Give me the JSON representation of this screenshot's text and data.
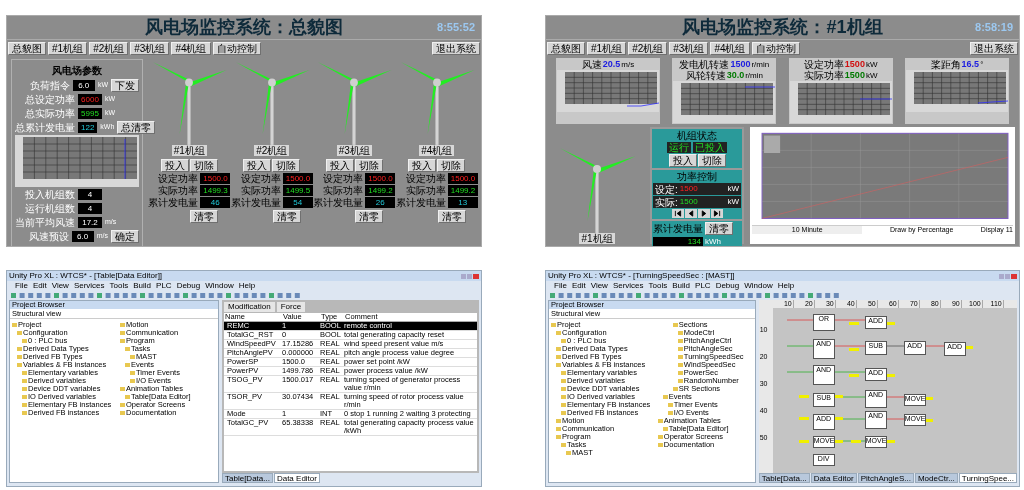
{
  "overview": {
    "title": "风电场监控系统：总貌图",
    "time": "8:55:52",
    "nav": [
      "总貌图",
      "#1机组",
      "#2机组",
      "#3机组",
      "#4机组",
      "自动控制"
    ],
    "exit_button": "退出系统",
    "farm_panel": {
      "title": "风电场参数",
      "top_rows": [
        {
          "label": "负荷指令",
          "value": "6.0",
          "unit": "kW",
          "button": "下发",
          "kind": "plain"
        },
        {
          "label": "总设定功率",
          "value": "6000",
          "unit": "kW",
          "kind": "setpoint"
        },
        {
          "label": "总实际功率",
          "value": "5995",
          "unit": "kW",
          "kind": "actual"
        },
        {
          "label": "总累计发电量",
          "value": "122",
          "unit": "kWh",
          "button": "总清零",
          "kind": "energy"
        }
      ],
      "bottom_rows": [
        {
          "label": "投入机组数",
          "value": "4",
          "kind": "plain"
        },
        {
          "label": "运行机组数",
          "value": "4",
          "kind": "plain"
        },
        {
          "label": "当前平均风速",
          "value": "17.2",
          "unit": "m/s",
          "kind": "plain"
        },
        {
          "label": "风速预设",
          "value": "6.0",
          "unit": "m/s",
          "button": "确定",
          "kind": "plain"
        }
      ]
    },
    "turbines": [
      {
        "name": "#1机组",
        "buttons": [
          "投入",
          "切除"
        ],
        "readings": [
          {
            "label": "设定功率",
            "value": "1500.0",
            "kind": "setpoint"
          },
          {
            "label": "实际功率",
            "value": "1499.3",
            "kind": "actual"
          },
          {
            "label": "累计发电量",
            "value": "46",
            "kind": "energy"
          }
        ],
        "clear_button": "清零"
      },
      {
        "name": "#2机组",
        "buttons": [
          "投入",
          "切除"
        ],
        "readings": [
          {
            "label": "设定功率",
            "value": "1500.0",
            "kind": "setpoint"
          },
          {
            "label": "实际功率",
            "value": "1499.5",
            "kind": "actual"
          },
          {
            "label": "累计发电量",
            "value": "54",
            "kind": "energy"
          }
        ],
        "clear_button": "清零"
      },
      {
        "name": "#3机组",
        "buttons": [
          "投入",
          "切除"
        ],
        "readings": [
          {
            "label": "设定功率",
            "value": "1500.0",
            "kind": "setpoint"
          },
          {
            "label": "实际功率",
            "value": "1499.2",
            "kind": "actual"
          },
          {
            "label": "累计发电量",
            "value": "26",
            "kind": "energy"
          }
        ],
        "clear_button": "清零"
      },
      {
        "name": "#4机组",
        "buttons": [
          "投入",
          "切除"
        ],
        "readings": [
          {
            "label": "设定功率",
            "value": "1500.0",
            "kind": "setpoint"
          },
          {
            "label": "实际功率",
            "value": "1499.2",
            "kind": "actual"
          },
          {
            "label": "累计发电量",
            "value": "13",
            "kind": "energy"
          }
        ],
        "clear_button": "清零"
      }
    ]
  },
  "unit_view": {
    "title": "风电场监控系统：#1机组",
    "time": "8:58:19",
    "nav": [
      "总貌图",
      "#1机组",
      "#2机组",
      "#3机组",
      "#4机组",
      "自动控制"
    ],
    "exit_button": "退出系统",
    "gauges": [
      {
        "captions": [
          {
            "label": "风速",
            "value": "20.5",
            "unit": "m/s",
            "kind": "process"
          }
        ]
      },
      {
        "captions": [
          {
            "label": "发电机转速",
            "value": "1500",
            "unit": "r/min",
            "kind": "process"
          },
          {
            "label": "风轮转速",
            "value": "30.0",
            "unit": "r/min",
            "kind": "actual"
          }
        ]
      },
      {
        "captions": [
          {
            "label": "设定功率",
            "value": "1500",
            "unit": "kW",
            "kind": "setpoint"
          },
          {
            "label": "实际功率",
            "value": "1500",
            "unit": "kW",
            "kind": "actual"
          }
        ]
      },
      {
        "captions": [
          {
            "label": "桨距角",
            "value": "16.5",
            "unit": "°",
            "kind": "process"
          }
        ]
      }
    ],
    "turbine_label": "#1机组",
    "status": {
      "title": "机组状态",
      "state": "运行",
      "input_state": "已投入",
      "buttons": [
        "投入",
        "切除"
      ]
    },
    "power": {
      "title": "功率控制",
      "rows": [
        {
          "label": "设定:",
          "value": "1500",
          "unit": "kW",
          "kind": "setpoint"
        },
        {
          "label": "实际:",
          "value": "1500",
          "unit": "kW",
          "kind": "actual"
        }
      ]
    },
    "energy": {
      "label": "累计发电量",
      "button": "清零",
      "value": "134",
      "unit": "kWh"
    },
    "trend": {
      "period": "10 Minute",
      "mode": "Draw by Percentage",
      "display": "Display 11"
    }
  },
  "data_editor_window": {
    "title": "Unity Pro XL : WTCS* - [Table[Data Editor]]",
    "menu": [
      "File",
      "Edit",
      "View",
      "Services",
      "Tools",
      "Build",
      "PLC",
      "Debug",
      "Window",
      "Help"
    ],
    "browser_title": "Project Browser",
    "view": "Structural view",
    "tree": [
      {
        "label": "Project",
        "children": [
          {
            "label": "Configuration",
            "children": [
              {
                "label": "0 : PLC bus"
              }
            ]
          },
          {
            "label": "Derived Data Types"
          },
          {
            "label": "Derived FB Types"
          },
          {
            "label": "Variables & FB instances",
            "children": [
              {
                "label": "Elementary variables"
              },
              {
                "label": "Derived variables"
              },
              {
                "label": "Device DDT variables"
              },
              {
                "label": "IO Derived variables"
              },
              {
                "label": "Elementary FB instances"
              },
              {
                "label": "Derived FB instances"
              }
            ]
          },
          {
            "label": "Motion"
          },
          {
            "label": "Communication"
          },
          {
            "label": "Program",
            "children": [
              {
                "label": "Tasks",
                "children": [
                  {
                    "label": "MAST"
                  }
                ]
              },
              {
                "label": "Events",
                "children": [
                  {
                    "label": "Timer Events"
                  },
                  {
                    "label": "I/O Events"
                  }
                ]
              }
            ]
          },
          {
            "label": "Animation Tables",
            "children": [
              {
                "label": "Table[Data Editor]"
              }
            ]
          },
          {
            "label": "Operator Screens"
          },
          {
            "label": "Documentation"
          }
        ]
      }
    ],
    "table_buttons": [
      "Modification",
      "Force"
    ],
    "columns": [
      "Name",
      "Value",
      "Type",
      "Comment"
    ],
    "rows": [
      {
        "name": "REMC",
        "value": "1",
        "type": "BOOL",
        "comment": "remote control",
        "selected": true
      },
      {
        "name": "TotalGC_RST",
        "value": "0",
        "type": "BOOL",
        "comment": "total generating capacity reset",
        "selected": false
      },
      {
        "name": "WindSpeedPV",
        "value": "17.15286",
        "type": "REAL",
        "comment": "wind speed present value m/s",
        "selected": false
      },
      {
        "name": "PitchAnglePV",
        "value": "0.000000",
        "type": "REAL",
        "comment": "pitch angle process value degree",
        "selected": false
      },
      {
        "name": "PowerSP",
        "value": "1500.0",
        "type": "REAL",
        "comment": "power set point /kW",
        "selected": false
      },
      {
        "name": "PowerPV",
        "value": "1499.786",
        "type": "REAL",
        "comment": "power process value /kW",
        "selected": false
      },
      {
        "name": "TSOG_PV",
        "value": "1500.017",
        "type": "REAL",
        "comment": "turning speed of generator process value r/min",
        "selected": false
      },
      {
        "name": "TSOR_PV",
        "value": "30.07434",
        "type": "REAL",
        "comment": "turning speed of rotor process value r/min",
        "selected": false
      },
      {
        "name": "Mode",
        "value": "1",
        "type": "INT",
        "comment": "0 stop 1 running 2 waiting 3 protecting",
        "selected": false
      },
      {
        "name": "TotalGC_PV",
        "value": "65.38338",
        "type": "REAL",
        "comment": "total generating capacity process value /kWh",
        "selected": false
      }
    ],
    "tabs": [
      {
        "label": "Table[Data...",
        "selected": false
      },
      {
        "label": "Data Editor",
        "selected": true
      }
    ]
  },
  "fbd_window": {
    "title": "Unity Pro XL : WTCS* - [TurningSpeedSec : [MAST]]",
    "menu": [
      "File",
      "Edit",
      "View",
      "Services",
      "Tools",
      "Build",
      "PLC",
      "Debug",
      "Window",
      "Help"
    ],
    "browser_title": "Project Browser",
    "view": "Structural view",
    "tree": [
      {
        "label": "Project",
        "children": [
          {
            "label": "Configuration",
            "children": [
              {
                "label": "0 : PLC bus"
              }
            ]
          },
          {
            "label": "Derived Data Types"
          },
          {
            "label": "Derived FB Types"
          },
          {
            "label": "Variables & FB instances",
            "children": [
              {
                "label": "Elementary variables"
              },
              {
                "label": "Derived variables"
              },
              {
                "label": "Device DDT variables"
              },
              {
                "label": "IO Derived variables"
              },
              {
                "label": "Elementary FB instances"
              },
              {
                "label": "Derived FB instances"
              }
            ]
          },
          {
            "label": "Motion"
          },
          {
            "label": "Communication"
          },
          {
            "label": "Program",
            "children": [
              {
                "label": "Tasks",
                "children": [
                  {
                    "label": "MAST",
                    "children": [
                      {
                        "label": "Sections",
                        "children": [
                          {
                            "label": "ModeCtrl"
                          },
                          {
                            "label": "PitchAngleCtrl"
                          },
                          {
                            "label": "PitchAngleSec"
                          },
                          {
                            "label": "TurningSpeedSec"
                          },
                          {
                            "label": "WindSpeedSec"
                          },
                          {
                            "label": "PowerSec"
                          },
                          {
                            "label": "RandomNumber"
                          }
                        ]
                      },
                      {
                        "label": "SR Sections"
                      }
                    ]
                  }
                ]
              },
              {
                "label": "Events",
                "children": [
                  {
                    "label": "Timer Events"
                  },
                  {
                    "label": "I/O Events"
                  }
                ]
              }
            ]
          },
          {
            "label": "Animation Tables",
            "children": [
              {
                "label": "Table[Data Editor]"
              }
            ]
          },
          {
            "label": "Operator Screens"
          },
          {
            "label": "Documentation"
          }
        ]
      }
    ],
    "ruler": [
      "10",
      "20",
      "30",
      "40",
      "50",
      "60",
      "70",
      "80",
      "90",
      "100",
      "110"
    ],
    "row_numbers": [
      "10",
      "20",
      "30",
      "40",
      "50"
    ],
    "blocks": [
      {
        "label": "OR"
      },
      {
        "label": "ADD"
      },
      {
        "label": "AND"
      },
      {
        "label": "SUB"
      },
      {
        "label": "ADD"
      },
      {
        "label": "ADD"
      },
      {
        "label": "AND"
      },
      {
        "label": "ADD"
      },
      {
        "label": "SUB"
      },
      {
        "label": "AND"
      },
      {
        "label": "MOVE"
      },
      {
        "label": "ADD"
      },
      {
        "label": "AND"
      },
      {
        "label": "MOVE"
      },
      {
        "label": "MOVE"
      },
      {
        "label": "MOVE"
      },
      {
        "label": "DIV"
      }
    ],
    "tabs": [
      {
        "label": "Table[Data...",
        "selected": false
      },
      {
        "label": "Data Editor",
        "selected": false
      },
      {
        "label": "PitchAngleS...",
        "selected": false
      },
      {
        "label": "ModeCtr...",
        "selected": false
      },
      {
        "label": "TurningSpee...",
        "selected": true
      }
    ]
  }
}
